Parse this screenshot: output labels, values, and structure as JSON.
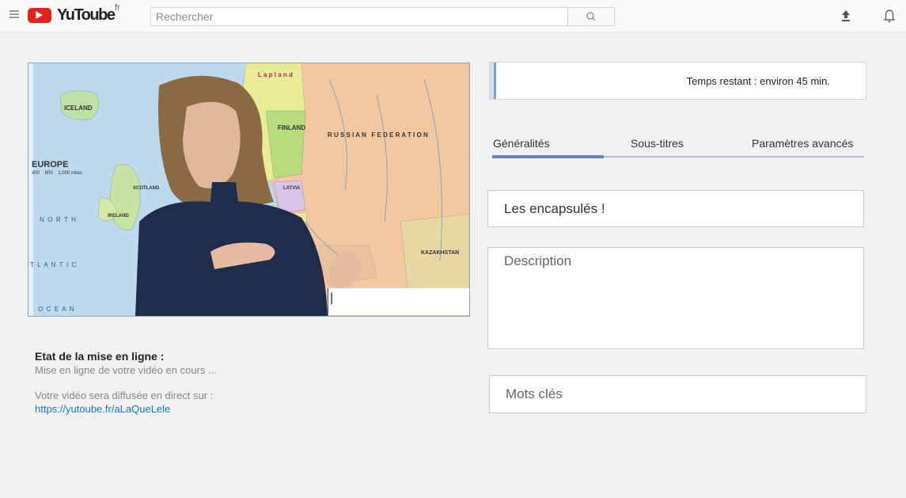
{
  "header": {
    "logo_text": "YuToube",
    "logo_sup": "fr",
    "search_placeholder": "Rechercher"
  },
  "video": {
    "map_labels": {
      "iceland": "ICELAND",
      "europe": "EUROPE",
      "scale": "400    800    1,000 miles",
      "finland": "FINLAND",
      "russia": "R U S S I A N   F E D E R A T I O N",
      "north": "N  O  R  T  H",
      "atlantic": "T  L  A  N  T  I  C",
      "ocean": "O  C  E  A  N",
      "kazakhstan": "KAZAKHSTAN",
      "ireland": "IRELAND",
      "scotland": "SCOTLAND",
      "latvia": "LATVIA",
      "lapland": "L a p l a n d"
    },
    "caption_cursor": "|"
  },
  "upload_status": {
    "title": "Etat de la mise en ligne :",
    "text": "Mise en ligne de votre vidéo en cours ...",
    "broadcast_label": "Votre vidéo sera diffusée en direct sur :",
    "broadcast_url": "https://yutoube.fr/aLaQueLele"
  },
  "progress": {
    "time_remaining": "Temps restant : environ 45 min.",
    "fraction": 0.01
  },
  "tabs": [
    {
      "label": "Généralités"
    },
    {
      "label": "Sous-titres"
    },
    {
      "label": "Paramètres avancés"
    }
  ],
  "form": {
    "title_value": "Les encapsulés !",
    "description_placeholder": "Description",
    "keywords_placeholder": "Mots clés"
  },
  "colors": {
    "logo_red": "#e62117",
    "tab_active": "#5b87c6",
    "link": "#167ac6"
  },
  "icons": [
    "menu-icon",
    "search-icon",
    "upload-icon",
    "bell-icon"
  ]
}
